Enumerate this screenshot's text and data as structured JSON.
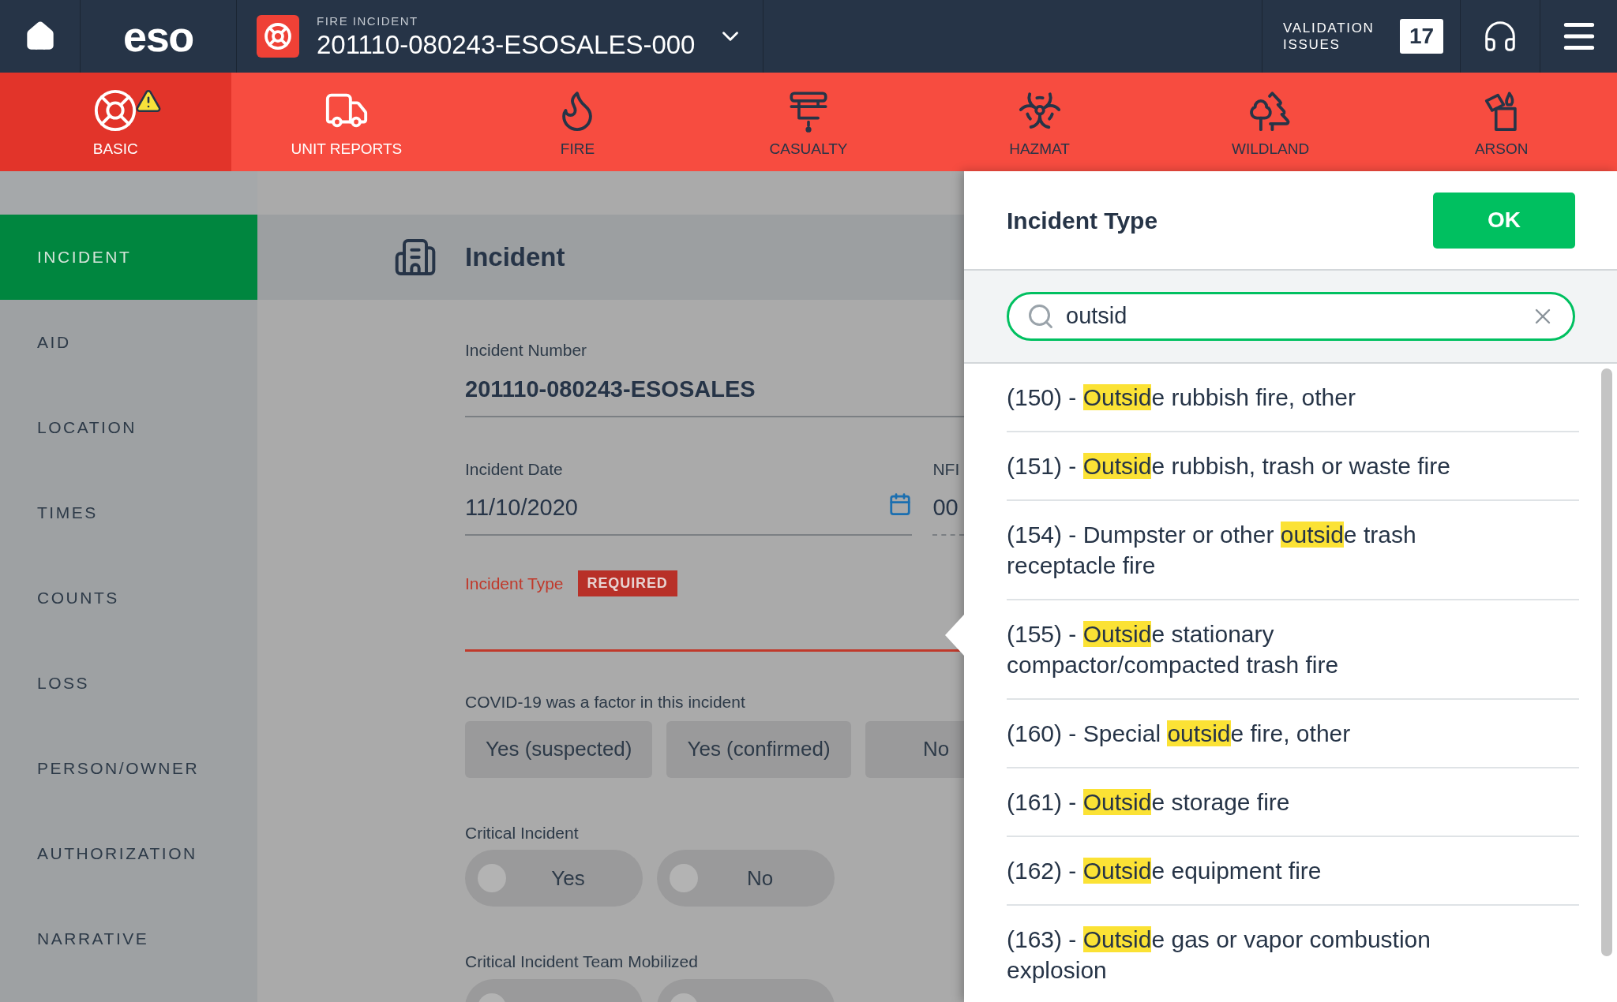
{
  "top_bar": {
    "logo": "eso",
    "record_type": "FIRE INCIDENT",
    "record_number": "201110-080243-ESOSALES-000",
    "validation_label": "VALIDATION ISSUES",
    "validation_count": "17"
  },
  "modules": [
    {
      "label": "BASIC",
      "selected": true,
      "active": true,
      "warning": true
    },
    {
      "label": "UNIT REPORTS",
      "selected": false,
      "active": true,
      "warning": false
    },
    {
      "label": "FIRE",
      "selected": false,
      "active": false,
      "warning": false
    },
    {
      "label": "CASUALTY",
      "selected": false,
      "active": false,
      "warning": false
    },
    {
      "label": "HAZMAT",
      "selected": false,
      "active": false,
      "warning": false
    },
    {
      "label": "WILDLAND",
      "selected": false,
      "active": false,
      "warning": false
    },
    {
      "label": "ARSON",
      "selected": false,
      "active": false,
      "warning": false
    }
  ],
  "sidebar": {
    "items": [
      {
        "label": "INCIDENT",
        "selected": true
      },
      {
        "label": "AID",
        "selected": false
      },
      {
        "label": "LOCATION",
        "selected": false
      },
      {
        "label": "TIMES",
        "selected": false
      },
      {
        "label": "COUNTS",
        "selected": false
      },
      {
        "label": "LOSS",
        "selected": false
      },
      {
        "label": "PERSON/OWNER",
        "selected": false
      },
      {
        "label": "AUTHORIZATION",
        "selected": false
      },
      {
        "label": "NARRATIVE",
        "selected": false
      }
    ]
  },
  "section": {
    "title": "Incident"
  },
  "form": {
    "incident_number": {
      "label": "Incident Number",
      "value": "201110-080243-ESOSALES"
    },
    "incident_date": {
      "label": "Incident Date",
      "value": "11/10/2020"
    },
    "nfirs": {
      "label": "NFI",
      "value": "00"
    },
    "incident_type": {
      "label": "Incident Type",
      "badge": "REQUIRED",
      "error": true
    },
    "covid": {
      "label": "COVID-19 was a factor in this incident",
      "options": [
        {
          "label": "Yes (suspected)",
          "selected": false
        },
        {
          "label": "Yes (confirmed)",
          "selected": false
        },
        {
          "label": "No",
          "selected": false
        }
      ]
    },
    "critical_incident": {
      "label": "Critical Incident",
      "options": [
        {
          "label": "Yes",
          "selected": false
        },
        {
          "label": "No",
          "selected": false
        }
      ]
    },
    "team_mobilized": {
      "label": "Critical Incident Team Mobilized",
      "options": [
        {
          "selected": false
        },
        {
          "selected": false
        }
      ]
    }
  },
  "picker": {
    "title": "Incident Type",
    "ok": "OK",
    "search": {
      "value": "outsid"
    },
    "results": [
      {
        "prefix": "(150) - ",
        "match": "Outsid",
        "suffix": "e rubbish fire, other"
      },
      {
        "prefix": "(151) - ",
        "match": "Outsid",
        "suffix": "e rubbish, trash or waste fire"
      },
      {
        "prefix": "(154) - Dumpster or other ",
        "match": "outsid",
        "suffix": "e trash receptacle fire"
      },
      {
        "prefix": "(155) - ",
        "match": "Outsid",
        "suffix": "e stationary compactor/compacted trash fire"
      },
      {
        "prefix": "(160) - Special ",
        "match": "outsid",
        "suffix": "e fire, other"
      },
      {
        "prefix": "(161) - ",
        "match": "Outsid",
        "suffix": "e storage fire"
      },
      {
        "prefix": "(162) - ",
        "match": "Outsid",
        "suffix": "e equipment fire"
      },
      {
        "prefix": "(163) - ",
        "match": "Outsid",
        "suffix": "e gas or vapor combustion explosion"
      }
    ]
  }
}
